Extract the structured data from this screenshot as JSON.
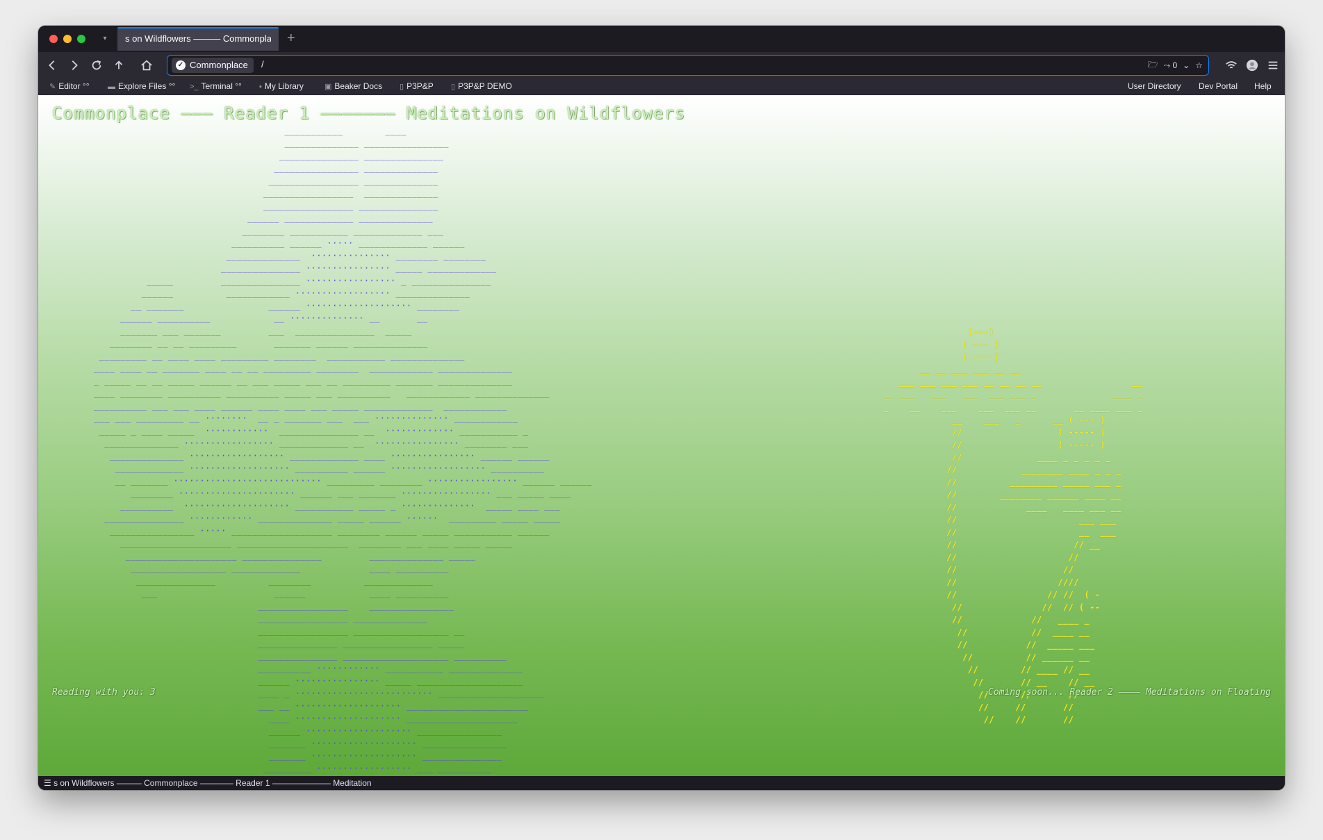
{
  "window": {
    "tab_title": "s on Wildflowers ——— Commonplac…",
    "tab_list_icon": "chevron-down-icon"
  },
  "navbar": {
    "site_name": "Commonplace",
    "url_path": "/",
    "share_count": "0"
  },
  "bookmarks": [
    {
      "label": "Editor °°",
      "icon": "pencil-icon"
    },
    {
      "label": "Explore Files °°",
      "icon": "folder-icon"
    },
    {
      "label": "Terminal °°",
      "icon": "terminal-icon"
    },
    {
      "label": "My Library",
      "icon": "library-icon"
    },
    {
      "label": "Beaker Docs",
      "icon": "beaker-icon"
    },
    {
      "label": "P3P&P",
      "icon": "page-icon"
    },
    {
      "label": "P3P&P DEMO",
      "icon": "page-icon"
    }
  ],
  "bookmarks_right": [
    {
      "label": "User Directory"
    },
    {
      "label": "Dev Portal"
    },
    {
      "label": "Help"
    }
  ],
  "content": {
    "heading": "Commonplace ——— Reader 1 ——————— Meditations on Wildflowers",
    "reading_with_you": "Reading with you: 3",
    "coming_soon": "Coming soon... Reader 2 ———— Meditations on Floating"
  },
  "status_bar": {
    "text": "s on Wildflowers ——— Commonplace ———— Reader 1 ——————— Meditation"
  },
  "colors": {
    "flower_ascii": "#5b47e0",
    "yellow_ascii": "#f2ea2a",
    "accent": "#0a84ff"
  }
}
